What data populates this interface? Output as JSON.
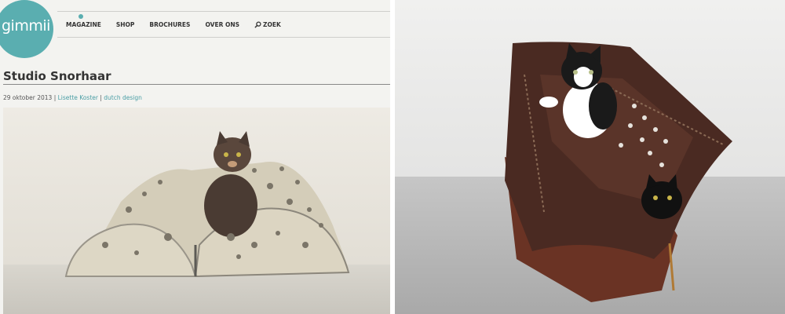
{
  "logo": {
    "text": "gimmii"
  },
  "nav": {
    "items": [
      "MAGAZINE",
      "SHOP",
      "BROCHURES",
      "OVER ONS"
    ],
    "search_label": "ZOEK"
  },
  "article": {
    "title": "Studio Snorhaar",
    "date": "29 oktober 2013",
    "separator1": " | ",
    "author": "Lisette Koster",
    "separator2": " | ",
    "category": "dutch design"
  },
  "colors": {
    "accent": "#5aaeb0",
    "link": "#4a9ea5",
    "felt": "#d6d0bf",
    "leather": "#4a2a22"
  },
  "images": {
    "left": "cat-in-felt-bag-photo",
    "right": "kittens-in-leather-bag-photo"
  }
}
